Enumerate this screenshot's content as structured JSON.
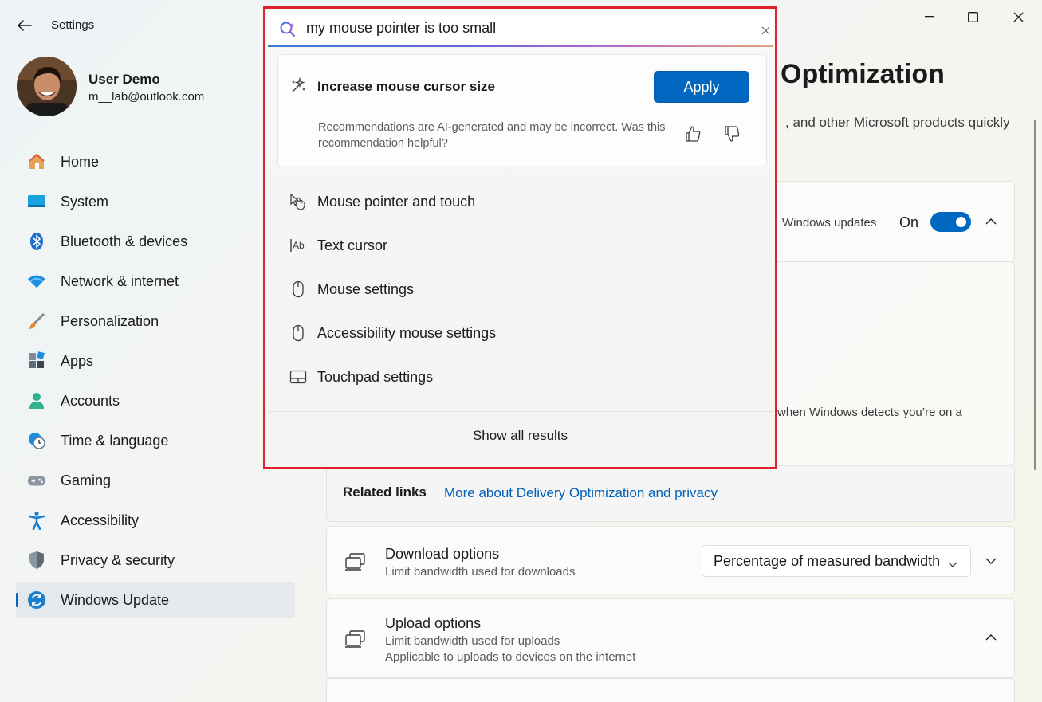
{
  "window": {
    "title": "Settings",
    "controls": [
      "minimize-icon",
      "maximize-icon",
      "close-icon"
    ]
  },
  "profile": {
    "name": "User Demo",
    "email": "m__lab@outlook.com"
  },
  "sidebar": {
    "items": [
      {
        "label": "Home",
        "icon": "home-icon"
      },
      {
        "label": "System",
        "icon": "system-icon"
      },
      {
        "label": "Bluetooth & devices",
        "icon": "bluetooth-icon"
      },
      {
        "label": "Network & internet",
        "icon": "wifi-icon"
      },
      {
        "label": "Personalization",
        "icon": "brush-icon"
      },
      {
        "label": "Apps",
        "icon": "apps-icon"
      },
      {
        "label": "Accounts",
        "icon": "accounts-icon"
      },
      {
        "label": "Time & language",
        "icon": "clock-globe-icon"
      },
      {
        "label": "Gaming",
        "icon": "gamepad-icon"
      },
      {
        "label": "Accessibility",
        "icon": "accessibility-icon"
      },
      {
        "label": "Privacy & security",
        "icon": "shield-icon"
      },
      {
        "label": "Windows Update",
        "icon": "update-icon",
        "active": true
      }
    ]
  },
  "main": {
    "title_fragment": "Optimization",
    "desc_fragment": ", and other Microsoft products quickly",
    "updates_fragment": "Windows updates",
    "toggle_label": "On",
    "toggle_on": true,
    "detect_fragment": "when Windows detects you’re on a",
    "related_label": "Related links",
    "related_link": "More about Delivery Optimization and privacy",
    "download": {
      "title": "Download options",
      "subtitle": "Limit bandwidth used for downloads",
      "select_value": "Percentage of measured bandwidth"
    },
    "upload": {
      "title": "Upload options",
      "subtitle": "Limit bandwidth used for uploads",
      "subtitle2": "Applicable to uploads to devices on the internet"
    }
  },
  "search": {
    "query": "my mouse pointer is too small",
    "recommendation": {
      "title": "Increase mouse cursor size",
      "apply_label": "Apply",
      "note": "Recommendations are AI-generated and may be incorrect. Was this recommendation helpful?"
    },
    "results": [
      {
        "label": "Mouse pointer and touch",
        "icon": "pointer-touch-icon"
      },
      {
        "label": "Text cursor",
        "icon": "text-cursor-icon"
      },
      {
        "label": "Mouse settings",
        "icon": "mouse-icon"
      },
      {
        "label": "Accessibility mouse settings",
        "icon": "mouse-icon"
      },
      {
        "label": "Touchpad settings",
        "icon": "touchpad-icon"
      }
    ],
    "show_all_label": "Show all results"
  },
  "colors": {
    "accent": "#0067c0",
    "highlight_border": "#e0202a"
  }
}
